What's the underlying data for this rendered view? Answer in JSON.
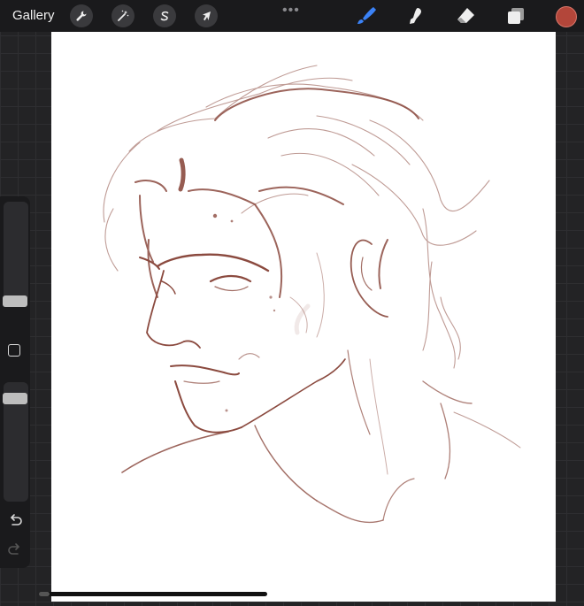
{
  "toolbar": {
    "gallery_label": "Gallery",
    "more_label": "•••",
    "current_color": "#b3463a",
    "brush_color": "#3b82f6"
  },
  "canvas": {
    "background": "#ffffff",
    "ink_color": "#8b4a3f"
  }
}
